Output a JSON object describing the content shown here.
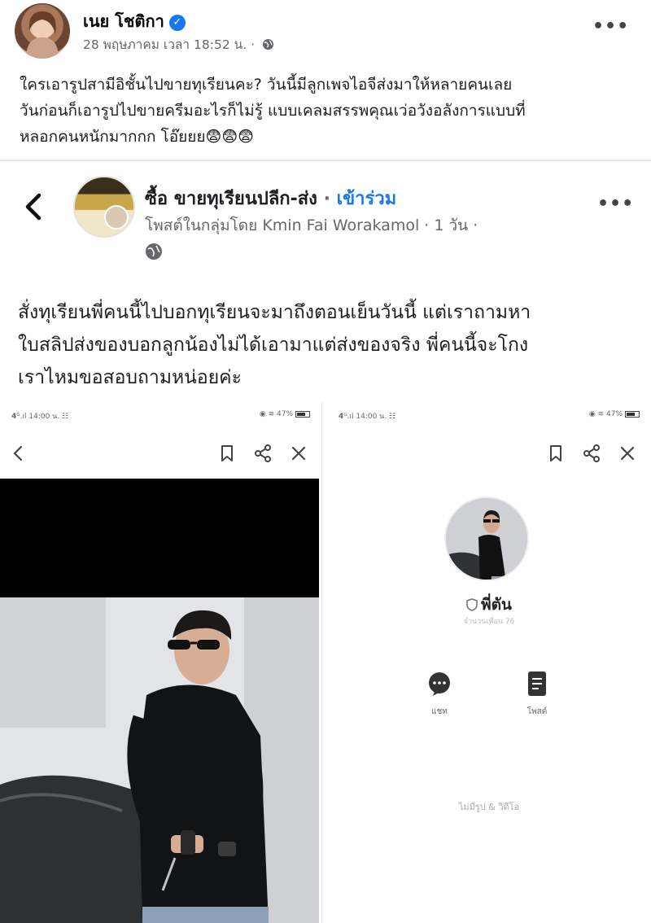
{
  "post": {
    "author": "เนย โชติกา",
    "verified_mark": "✓",
    "meta": "28 พฤษภาคม เวลา 18:52 น. ·",
    "more": "•••",
    "text_lines": [
      "ใครเอารูปสามีอิชั้นไปขายทุเรียนคะ? วันนี้มีลูกเพจไอจีส่งมาให้หลายคนเลย",
      "วันก่อนก็เอารูปไปขายครีมอะไรก็ไม่รู้ แบบเคลมสรรพคุณเว่อวังอลังการแบบที่",
      "หลอกคนหนักมากกก โอ๊ยยย😨😨😨"
    ]
  },
  "shared": {
    "group_name": "ซื้อ ขายทุเรียนปลีก-ส่ง",
    "separator": " · ",
    "join_label": "เข้าร่วม",
    "meta": "โพสต์ในกลุ่มโดย Kmin Fai Worakamol · 1 วัน ·",
    "more": "•••",
    "text_lines": [
      "สั่งทุเรียนพี่คนนี้ไปบอกทุเรียนจะมาถึงตอนเย็นวันนี้ แต่เราถามหา",
      "ใบสลิปส่งของบอกลูกน้องไม่ได้เอามาแต่ส่งของจริง พี่คนนี้จะโกง",
      "เราไหมขอสอบถามหน่อยค่ะ"
    ]
  },
  "screenshots": {
    "left": {
      "status_left": "𝟰ᴳ.ıl 14:00 น. ☷",
      "status_right": "◉ ≋ 47%"
    },
    "right": {
      "status_left": "𝟰ᴳ.ıl 14:00 น. ☷",
      "status_right": "◉ ≋ 47%",
      "profile_name": "พี่ตัน",
      "profile_sub": "จำนวนเพื่อน 76",
      "chat_label": "แชท",
      "posts_label": "โพสต์",
      "empty_note": "ไม่มีรูป & วิดีโอ"
    }
  },
  "icons": {
    "verified": "verified-badge-icon",
    "globe": "globe-icon",
    "back": "chevron-left-icon",
    "bookmark": "bookmark-icon",
    "share": "share-icon",
    "close": "close-icon",
    "chat": "chat-bubble-icon",
    "posts": "document-icon",
    "shield": "shield-icon"
  },
  "colors": {
    "link_blue": "#1877f2",
    "meta_gray": "#65676b"
  }
}
